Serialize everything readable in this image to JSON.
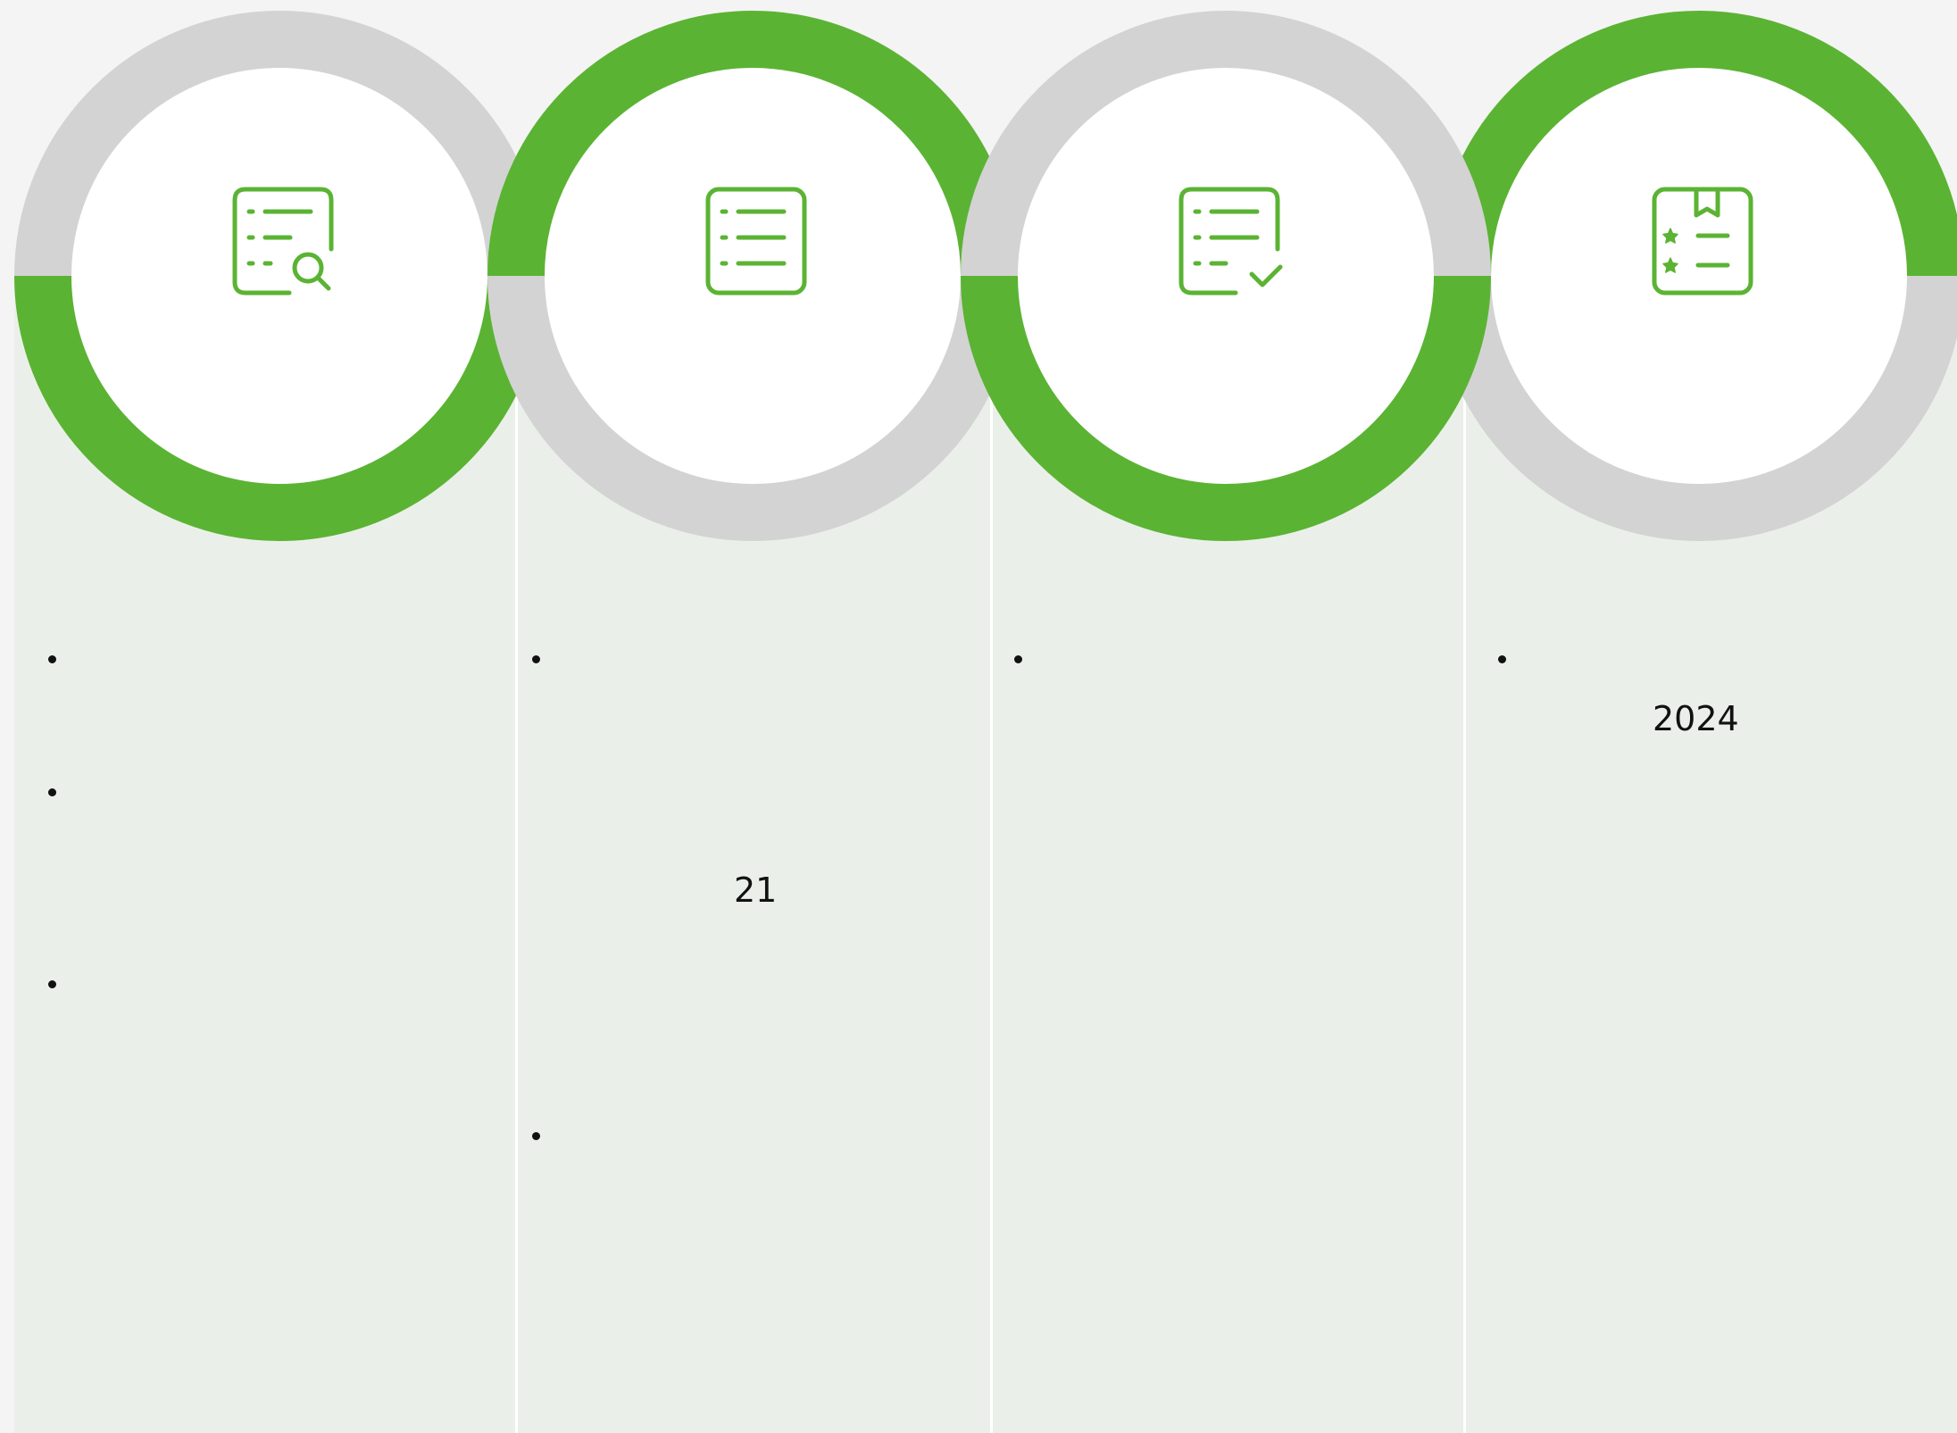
{
  "colors": {
    "accent": "#5bb333",
    "ring_track": "#d3d3d3",
    "column_bg": "#eaf0e9",
    "page_bg": "#f4f4f4"
  },
  "stages": [
    {
      "icon": "report-search-icon",
      "ring_progress": 0.5,
      "bullet_count": 3,
      "value": ""
    },
    {
      "icon": "list-details-icon",
      "ring_progress": 0.5,
      "bullet_count": 2,
      "value": "21"
    },
    {
      "icon": "checklist-icon",
      "ring_progress": 0.5,
      "bullet_count": 1,
      "value": ""
    },
    {
      "icon": "bookmark-star-list-icon",
      "ring_progress": 0.5,
      "bullet_count": 1,
      "value": "2024"
    }
  ]
}
